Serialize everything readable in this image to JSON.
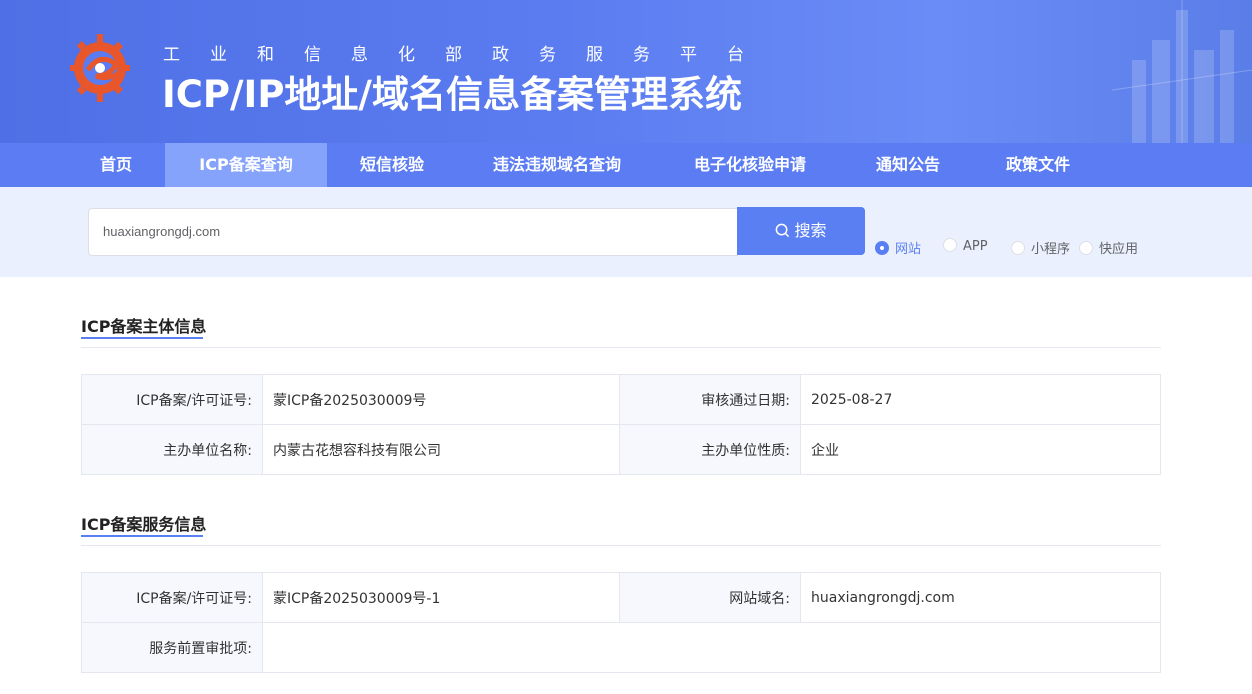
{
  "header": {
    "subtitle": "工业和信息化部政务服务平台",
    "title": "ICP/IP地址/域名信息备案管理系统"
  },
  "nav": {
    "items": [
      {
        "label": "首页"
      },
      {
        "label": "ICP备案查询"
      },
      {
        "label": "短信核验"
      },
      {
        "label": "违法违规域名查询"
      },
      {
        "label": "电子化核验申请"
      },
      {
        "label": "通知公告"
      },
      {
        "label": "政策文件"
      }
    ],
    "active": "ICP备案查询"
  },
  "search": {
    "value": "huaxiangrongdj.com",
    "button_label": "搜索",
    "options": [
      {
        "label": "网站",
        "checked": true
      },
      {
        "label": "APP",
        "checked": false
      },
      {
        "label": "小程序",
        "checked": false
      },
      {
        "label": "快应用",
        "checked": false
      }
    ]
  },
  "subject_info": {
    "title": "ICP备案主体信息",
    "rows": [
      {
        "label1": "ICP备案/许可证号:",
        "value1": "蒙ICP备2025030009号",
        "label2": "审核通过日期:",
        "value2": "2025-08-27"
      },
      {
        "label1": "主办单位名称:",
        "value1": "内蒙古花想容科技有限公司",
        "label2": "主办单位性质:",
        "value2": "企业"
      }
    ]
  },
  "service_info": {
    "title": "ICP备案服务信息",
    "rows": [
      {
        "label1": "ICP备案/许可证号:",
        "value1": "蒙ICP备2025030009号-1",
        "label2": "网站域名:",
        "value2": "huaxiangrongdj.com"
      },
      {
        "label1": "服务前置审批项:",
        "value1": ""
      }
    ]
  },
  "colors": {
    "primary": "#5a7ff3",
    "nav_bg": "#5b7cf3",
    "nav_active": "#86a3fb",
    "search_band": "#eaf0fd"
  }
}
